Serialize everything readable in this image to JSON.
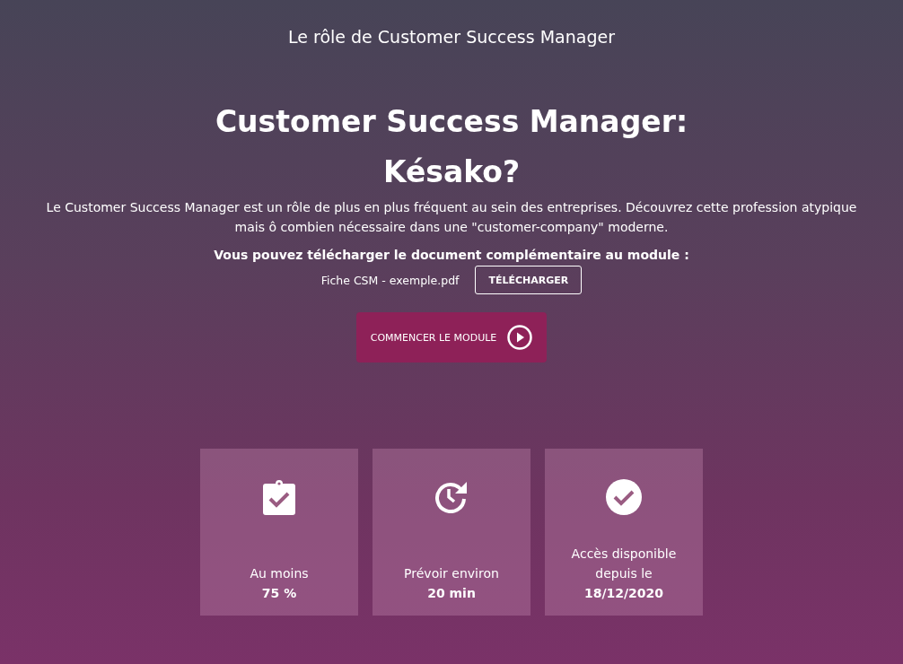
{
  "page_title": "Le rôle de Customer Success Manager",
  "heading": "Customer Success Manager: Késako?",
  "description": "Le Customer Success Manager est un rôle de plus en plus fréquent au sein des entreprises. Découvrez cette profession atypique mais ô combien nécessaire dans une \"customer-company\" moderne.",
  "download": {
    "prompt": "Vous pouvez télécharger le document complémentaire au module :",
    "file_name": "Fiche CSM - exemple.pdf",
    "button": "TÉLÉCHARGER"
  },
  "start_button": "COMMENCER LE MODULE",
  "cards": [
    {
      "kind": "score",
      "label": "Au moins",
      "value": "75 %"
    },
    {
      "kind": "duration",
      "label": "Prévoir environ",
      "value": "20 min"
    },
    {
      "kind": "availability",
      "label": "Accès disponible depuis le",
      "value": "18/12/2020"
    }
  ]
}
